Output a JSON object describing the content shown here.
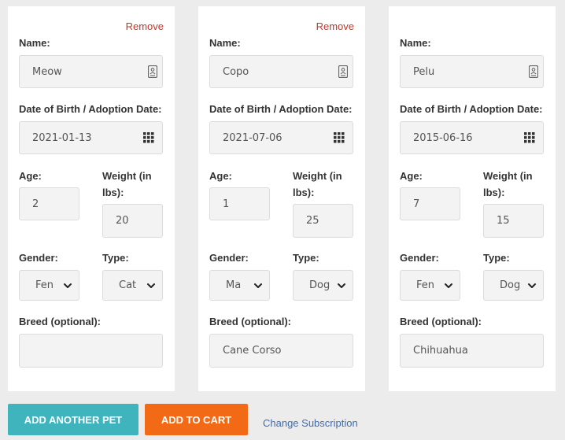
{
  "labels": {
    "name": "Name:",
    "dob": "Date of Birth / Adoption Date:",
    "age": "Age:",
    "weight": "Weight (in lbs):",
    "gender": "Gender:",
    "type": "Type:",
    "breed": "Breed (optional):",
    "remove": "Remove"
  },
  "pets": [
    {
      "name": "Meow",
      "dob": "2021-01-13",
      "age": "2",
      "weight": "20",
      "gender": "Fen",
      "type": "Cat",
      "breed": "",
      "removable": true
    },
    {
      "name": "Copo",
      "dob": "2021-07-06",
      "age": "1",
      "weight": "25",
      "gender": "Ma",
      "type": "Dog",
      "breed": "Cane Corso",
      "removable": true
    },
    {
      "name": "Pelu",
      "dob": "2015-06-16",
      "age": "7",
      "weight": "15",
      "gender": "Fen",
      "type": "Dog",
      "breed": "Chihuahua",
      "removable": false
    }
  ],
  "actions": {
    "add_pet": "ADD ANOTHER PET",
    "add_cart": "ADD TO CART",
    "change_sub": "Change Subscription"
  },
  "colors": {
    "accent_teal": "#3fb4bd",
    "accent_orange": "#f26a15",
    "remove_red": "#c0392b",
    "link_blue": "#3d6cb3"
  },
  "icons": {
    "name_field": "contact-card-icon",
    "date_field": "calendar-grid-icon",
    "select": "chevron-down-icon"
  }
}
